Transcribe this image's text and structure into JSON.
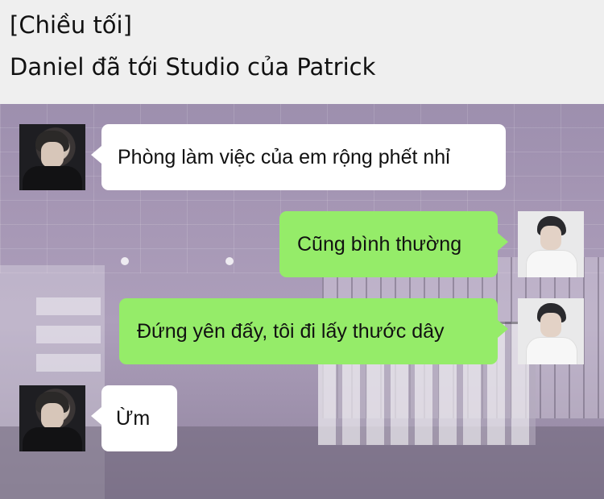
{
  "header": {
    "scene_time": "[Chiều tối]",
    "scene_description": "Daniel đã tới Studio của Patrick"
  },
  "chat": {
    "messages": [
      {
        "sender": "left",
        "text": "Phòng làm việc của em rộng phết nhỉ"
      },
      {
        "sender": "right",
        "text": "Cũng bình thường"
      },
      {
        "sender": "right",
        "text": "Đứng yên đấy, tôi đi lấy thước dây"
      },
      {
        "sender": "left",
        "text": "Ừm"
      }
    ]
  },
  "colors": {
    "header_bg": "#efefef",
    "incoming_bubble": "#ffffff",
    "outgoing_bubble": "#95ec69"
  }
}
